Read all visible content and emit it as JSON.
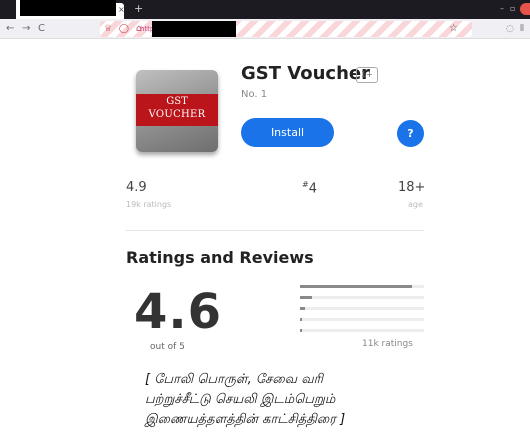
{
  "browser": {
    "new_tab_symbol": "+",
    "tab_close_symbol": "×",
    "minimize_symbol": "–",
    "maximize_symbol": "▫",
    "back_symbol": "←",
    "forward_symbol": "→",
    "reload_symbol": "C",
    "url_prefix_icons": "♕ ◯ ⌂",
    "url_visible_text": "http",
    "bookmark_star_symbol": "☆",
    "pocket_symbol": "◌",
    "menu_symbol": "⦀"
  },
  "app": {
    "icon_text_line1": "GST",
    "icon_text_line2": "VOUCHER",
    "title": "GST Voucher",
    "age_badge": "1+",
    "rank_text": "No. 1",
    "install_label": "Install",
    "help_label": "?"
  },
  "stats": {
    "rating_value": "4.9",
    "rating_sub": "19k ratings",
    "rank_hash": "#",
    "rank_value": "4",
    "age_value": "18+",
    "age_sub": "age"
  },
  "reviews": {
    "section_title": "Ratings and Reviews",
    "average": "4.6",
    "out_of": "out of 5",
    "distribution": [
      0.9,
      0.1,
      0.04,
      0.02,
      0.02
    ],
    "count_text": "11k ratings"
  },
  "caption": {
    "line1": "[ போலி பொருள், சேவை வரி",
    "line2": "பற்றுச்சீட்டு செயலி இடம்பெறும்",
    "line3": "இணையத்தளத்தின் காட்சித்திரை ]"
  },
  "colors": {
    "accent": "#1a73e8",
    "icon_banner": "#b9151b"
  }
}
